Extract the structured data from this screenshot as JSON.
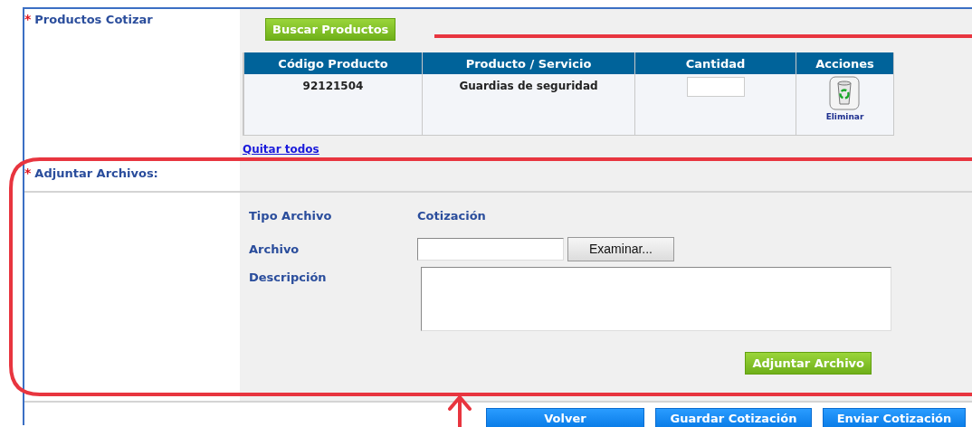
{
  "sections": [
    {
      "required_mark": "*",
      "label": "Productos Cotizar"
    },
    {
      "required_mark": "*",
      "label": "Adjuntar Archivos:"
    }
  ],
  "search_button": "Buscar Productos",
  "products_table": {
    "columns": [
      "Código Producto",
      "Producto / Servicio",
      "Cantidad",
      "Acciones"
    ],
    "rows": [
      {
        "code": "92121504",
        "product": "Guardias de seguridad",
        "action": "Eliminar"
      }
    ]
  },
  "remove_all_link": "Quitar todos",
  "attach_form": {
    "file_type_label": "Tipo Archivo",
    "file_type_value": "Cotización",
    "file_label": "Archivo",
    "browse_button": "Examinar...",
    "description_label": "Descripción",
    "attach_button": "Adjuntar Archivo"
  },
  "footer_buttons": [
    "Volver",
    "Guardar Cotización",
    "Enviar Cotización"
  ]
}
